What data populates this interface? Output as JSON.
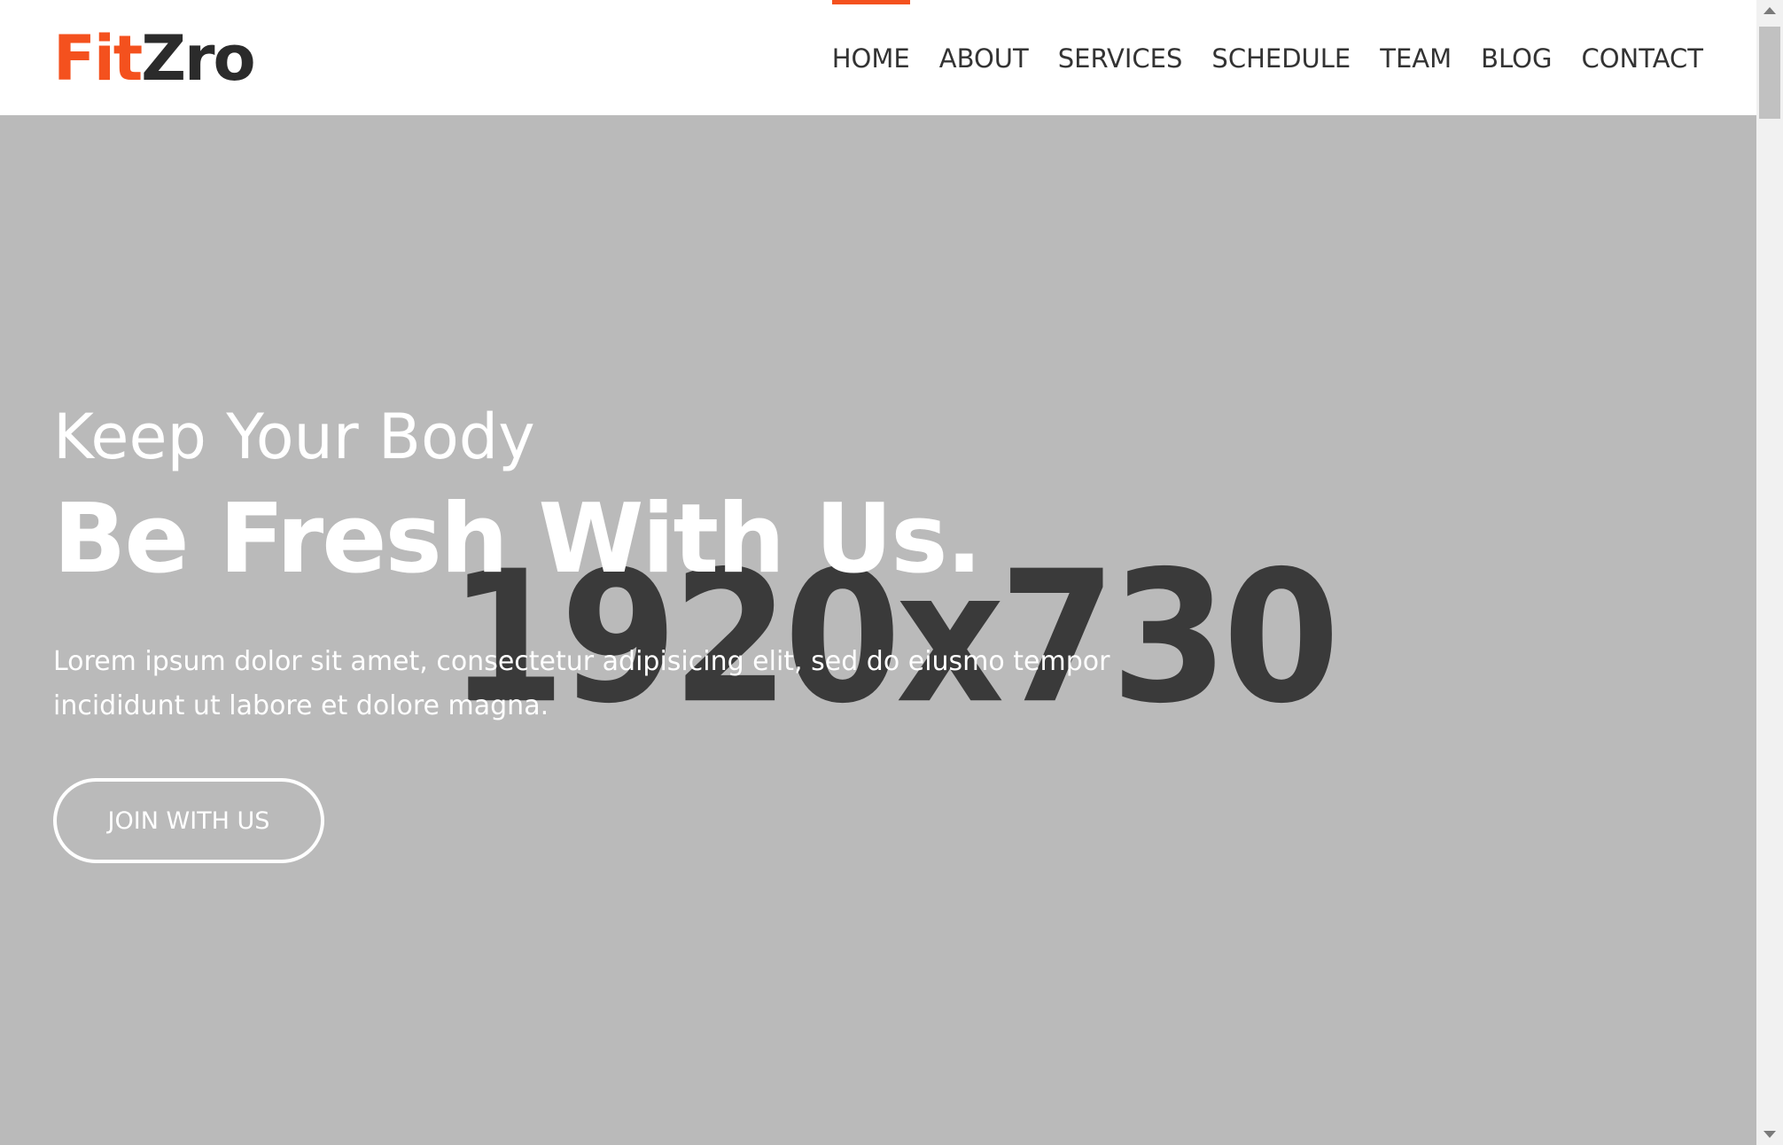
{
  "brand": {
    "logo_part1": "Fit",
    "logo_part2": "Zro",
    "accent_color": "#f4511e",
    "dark_color": "#2b2b2b"
  },
  "nav": {
    "items": [
      {
        "label": "HOME",
        "active": true
      },
      {
        "label": "ABOUT",
        "active": false
      },
      {
        "label": "SERVICES",
        "active": false
      },
      {
        "label": "SCHEDULE",
        "active": false
      },
      {
        "label": "TEAM",
        "active": false
      },
      {
        "label": "BLOG",
        "active": false
      },
      {
        "label": "CONTACT",
        "active": false
      }
    ]
  },
  "hero": {
    "placeholder_text": "1920x730",
    "subtitle": "Keep Your Body",
    "title": "Be Fresh With Us.",
    "description": "Lorem ipsum dolor sit amet, consectetur adipisicing elit, sed do eiusmo tempor incididunt ut labore et dolore magna.",
    "cta_label": "JOIN WITH US",
    "background_color": "#bababa"
  }
}
